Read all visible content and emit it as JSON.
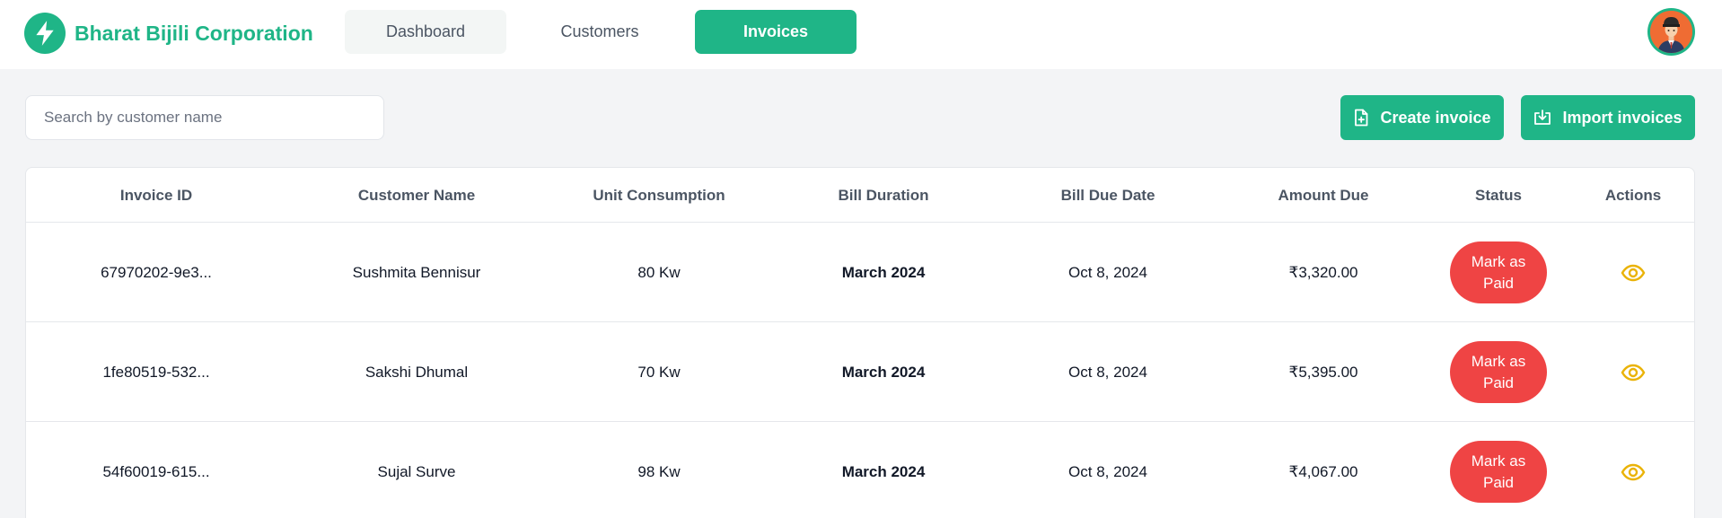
{
  "brand": {
    "name": "Bharat Bijili Corporation",
    "logo_icon": "lightning-bolt-icon",
    "color": "#1fb587"
  },
  "nav": {
    "tabs": [
      {
        "label": "Dashboard",
        "active": false
      },
      {
        "label": "Customers",
        "active": false
      },
      {
        "label": "Invoices",
        "active": true
      }
    ]
  },
  "user": {
    "avatar_icon": "user-avatar-icon"
  },
  "toolbar": {
    "search_placeholder": "Search by customer name",
    "create_label": "Create invoice",
    "create_icon": "file-plus-icon",
    "import_label": "Import invoices",
    "import_icon": "download-icon"
  },
  "table": {
    "columns": [
      "Invoice ID",
      "Customer Name",
      "Unit Consumption",
      "Bill Duration",
      "Bill Due Date",
      "Amount Due",
      "Status",
      "Actions"
    ],
    "rows": [
      {
        "id": "67970202-9e3...",
        "customer": "Sushmita Bennisur",
        "units": "80 Kw",
        "duration": "March 2024",
        "due_date": "Oct 8, 2024",
        "amount": "₹3,320.00",
        "status": "Mark as Paid"
      },
      {
        "id": "1fe80519-532...",
        "customer": "Sakshi Dhumal",
        "units": "70 Kw",
        "duration": "March 2024",
        "due_date": "Oct 8, 2024",
        "amount": "₹5,395.00",
        "status": "Mark as Paid"
      },
      {
        "id": "54f60019-615...",
        "customer": "Sujal Surve",
        "units": "98 Kw",
        "duration": "March 2024",
        "due_date": "Oct 8, 2024",
        "amount": "₹4,067.00",
        "status": "Mark as Paid"
      }
    ]
  },
  "colors": {
    "accent": "#1fb587",
    "status_unpaid": "#ef4444",
    "action_icon": "#eab308"
  }
}
